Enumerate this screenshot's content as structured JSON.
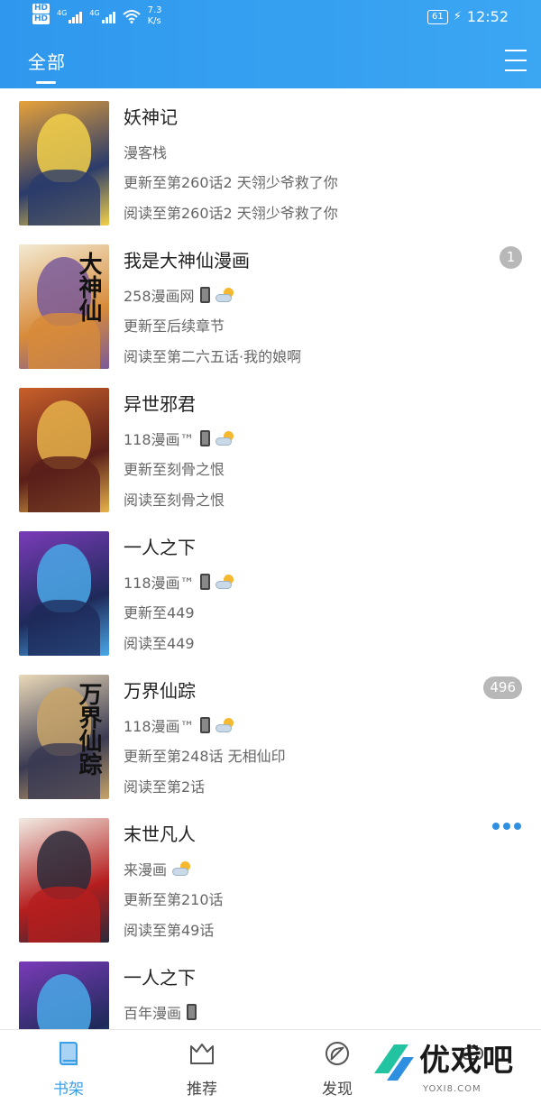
{
  "status_bar": {
    "hd_badges": [
      "HD",
      "HD"
    ],
    "net_labels": [
      "4G",
      "4G"
    ],
    "speed_value": "7.3",
    "speed_unit": "K/s",
    "battery": "61",
    "time": "12:52"
  },
  "header": {
    "tab_label": "全部",
    "menu_icon": "hamburger-menu-icon"
  },
  "comics": [
    {
      "title": "妖神记",
      "source": "漫客栈",
      "source_icons": [],
      "updated": "更新至第260话2 天翎少爷救了你",
      "read": "阅读至第260话2 天翎少爷救了你",
      "badge": "",
      "cover_colors": [
        "#e7a23a",
        "#2b3b6a",
        "#f2d04a"
      ]
    },
    {
      "title": "我是大神仙漫画",
      "source": "258漫画网",
      "source_icons": [
        "phone-icon",
        "cloud-sun-icon"
      ],
      "updated": "更新至后续章节",
      "read": "阅读至第二六五话·我的娘啊",
      "badge": "1",
      "cover_text": "大神仙",
      "cover_colors": [
        "#f3ead2",
        "#d78b3a",
        "#7a5a9a"
      ]
    },
    {
      "title": "异世邪君",
      "source": "118漫画™",
      "source_icons": [
        "phone-icon",
        "cloud-sun-icon"
      ],
      "updated": "更新至刻骨之恨",
      "read": "阅读至刻骨之恨",
      "badge": "",
      "cover_colors": [
        "#c9602a",
        "#5a1f1a",
        "#e6b24a"
      ]
    },
    {
      "title": "一人之下",
      "source": "118漫画™",
      "source_icons": [
        "phone-icon",
        "cloud-sun-icon"
      ],
      "updated": "更新至449",
      "read": "阅读至449",
      "badge": "",
      "cover_colors": [
        "#7a3bb8",
        "#1e2a5a",
        "#4aa8e8"
      ]
    },
    {
      "title": "万界仙踪",
      "source": "118漫画™",
      "source_icons": [
        "phone-icon",
        "cloud-sun-icon"
      ],
      "updated": "更新至第248话 无相仙印",
      "read": "阅读至第2话",
      "badge": "496",
      "cover_text": "万界仙踪",
      "cover_colors": [
        "#ead9b8",
        "#3a3a52",
        "#c8a46a"
      ]
    },
    {
      "title": "末世凡人",
      "source": "来漫画",
      "source_icons": [
        "cloud-sun-icon"
      ],
      "updated": "更新至第210话",
      "read": "阅读至第49话",
      "badge": "",
      "more": true,
      "cover_colors": [
        "#f1ece4",
        "#b51e1e",
        "#2a2a3a"
      ]
    },
    {
      "title": "一人之下",
      "source": "百年漫画",
      "source_icons": [
        "phone-icon"
      ],
      "updated": "",
      "read": "",
      "badge": "",
      "cover_colors": [
        "#7a3bb8",
        "#1e2a5a",
        "#4aa8e8"
      ]
    }
  ],
  "bottom_nav": [
    {
      "label": "书架",
      "icon": "bookshelf-icon",
      "active": true
    },
    {
      "label": "推荐",
      "icon": "crown-icon",
      "active": false
    },
    {
      "label": "发现",
      "icon": "leaf-compass-icon",
      "active": false
    },
    {
      "label": "",
      "icon": "game-controller-icon",
      "active": false
    }
  ],
  "watermark": {
    "text": "优戏吧",
    "sub": "YOXI8.COM"
  },
  "colors": {
    "header_blue": "#2f98ee",
    "active_blue": "#3b9fe8",
    "text_main": "#222222",
    "text_secondary": "#666666",
    "badge_gray": "#b8b8b8"
  }
}
